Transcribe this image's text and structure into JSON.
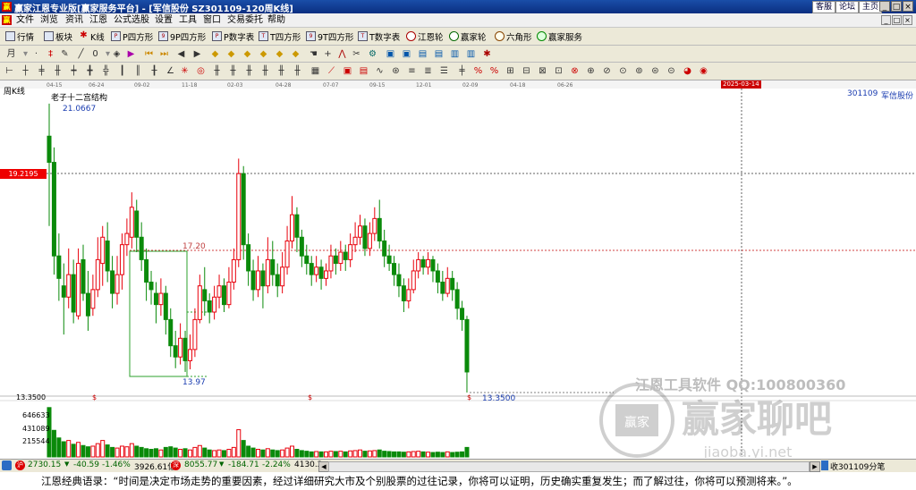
{
  "window": {
    "app_icon": "赢",
    "title": "赢家江恩专业版[赢家服务平台] - [军信股份  SZ301109-120周K线]",
    "links": [
      "客服",
      "论坛",
      "主页"
    ],
    "controls": [
      "_",
      "□",
      "×"
    ]
  },
  "menu": {
    "items": [
      "文件",
      "浏览",
      "资讯",
      "江恩",
      "公式选股",
      "设置",
      "工具",
      "窗口",
      "交易委托",
      "帮助"
    ],
    "controls": [
      "_",
      "□",
      "×"
    ]
  },
  "toolbar": {
    "items": [
      "行情",
      "板块",
      "K线",
      "P四方形",
      "9P四方形",
      "P数字表",
      "T四方形",
      "9T四方形",
      "T数字表",
      "江恩轮",
      "赢家轮",
      "六角形",
      "赢家服务"
    ]
  },
  "chart": {
    "period_label": "周K线",
    "structure_label": "老子十二宫结构",
    "stock_code": "301109",
    "stock_name": "军信股份",
    "date_ticks": [
      "04-15",
      "06-24",
      "09-02",
      "11-18",
      "02-03",
      "04-28",
      "07-07",
      "09-15",
      "12-01",
      "02-09",
      "04-18",
      "06-26"
    ],
    "cursor_date": "2025-03-14",
    "cursor_price": "19.2195",
    "high_label": "21.0667",
    "low_label": "13.3500",
    "box_top_label": "17.20",
    "box_bottom_label": "13.97",
    "price_axis_bottom": "13.3500",
    "volume_ticks": [
      "646633",
      "431089",
      "215544"
    ],
    "watermark_line1": "江恩工具软件  QQ:100800360",
    "watermark_brand": "赢家聊吧",
    "watermark_sub": "赢家",
    "watermark_url": "jiaoba.yi.net",
    "colors": {
      "up": "#e8000b",
      "down": "#0a8a0a",
      "box": "#2ca02c",
      "cursor": "#606060",
      "red_line": "#d04040"
    }
  },
  "chart_data": {
    "type": "candlestick",
    "note_candles": "[open, close, high, low]",
    "candles": [
      [
        20.2,
        19.5,
        21.07,
        17.8
      ],
      [
        19.5,
        17.0,
        19.9,
        16.5
      ],
      [
        17.0,
        16.4,
        17.6,
        15.8
      ],
      [
        16.2,
        15.9,
        16.8,
        14.9
      ],
      [
        15.9,
        16.5,
        17.2,
        15.6
      ],
      [
        16.5,
        15.5,
        16.9,
        15.2
      ],
      [
        15.4,
        16.8,
        17.2,
        15.3
      ],
      [
        16.9,
        16.0,
        17.3,
        15.8
      ],
      [
        16.0,
        15.4,
        16.6,
        15.0
      ],
      [
        15.6,
        16.1,
        16.5,
        15.4
      ],
      [
        16.1,
        16.9,
        17.5,
        15.9
      ],
      [
        16.8,
        17.5,
        17.8,
        16.2
      ],
      [
        17.4,
        16.6,
        17.9,
        16.3
      ],
      [
        16.6,
        16.0,
        17.0,
        15.6
      ],
      [
        16.0,
        16.5,
        17.0,
        15.7
      ],
      [
        16.5,
        17.3,
        17.6,
        16.1
      ],
      [
        17.3,
        17.6,
        18.0,
        17.0
      ],
      [
        17.5,
        18.3,
        18.7,
        17.2
      ],
      [
        18.2,
        17.5,
        18.5,
        17.1
      ],
      [
        17.5,
        16.9,
        17.9,
        16.6
      ],
      [
        16.9,
        16.3,
        17.2,
        15.8
      ],
      [
        16.3,
        16.1,
        16.6,
        15.7
      ],
      [
        16.0,
        15.7,
        16.3,
        15.2
      ],
      [
        15.7,
        16.0,
        16.4,
        15.4
      ],
      [
        16.0,
        15.3,
        16.2,
        14.9
      ],
      [
        15.3,
        14.6,
        15.6,
        14.3
      ],
      [
        14.6,
        14.3,
        15.0,
        14.0
      ],
      [
        14.3,
        14.8,
        15.2,
        14.1
      ],
      [
        14.8,
        14.2,
        15.0,
        13.9
      ],
      [
        14.2,
        14.5,
        14.9,
        13.97
      ],
      [
        14.5,
        15.3,
        15.6,
        14.3
      ],
      [
        15.3,
        16.2,
        16.5,
        15.2
      ],
      [
        16.1,
        15.8,
        16.7,
        15.4
      ],
      [
        15.8,
        15.5,
        16.0,
        15.2
      ],
      [
        15.5,
        15.9,
        16.2,
        15.3
      ],
      [
        15.9,
        16.2,
        16.5,
        15.6
      ],
      [
        16.2,
        15.7,
        16.4,
        15.5
      ],
      [
        15.7,
        16.3,
        16.7,
        15.6
      ],
      [
        16.3,
        16.9,
        17.2,
        16.1
      ],
      [
        16.9,
        19.2,
        19.6,
        16.7
      ],
      [
        19.2,
        17.3,
        19.4,
        16.9
      ],
      [
        17.3,
        16.6,
        17.6,
        16.2
      ],
      [
        16.6,
        16.1,
        16.9,
        15.8
      ],
      [
        16.1,
        16.6,
        17.0,
        15.9
      ],
      [
        16.6,
        16.2,
        16.8,
        15.6
      ],
      [
        16.2,
        16.9,
        17.5,
        16.0
      ],
      [
        16.9,
        16.5,
        17.4,
        16.2
      ],
      [
        16.5,
        16.2,
        16.8,
        15.9
      ],
      [
        16.2,
        16.7,
        17.1,
        16.0
      ],
      [
        16.7,
        17.4,
        17.8,
        16.5
      ],
      [
        17.4,
        18.1,
        18.6,
        17.2
      ],
      [
        18.1,
        17.5,
        18.3,
        17.1
      ],
      [
        17.5,
        17.0,
        17.7,
        16.7
      ],
      [
        17.0,
        16.8,
        17.3,
        16.5
      ],
      [
        16.8,
        16.5,
        17.0,
        16.2
      ],
      [
        16.5,
        16.7,
        17.0,
        16.3
      ],
      [
        16.7,
        16.4,
        16.9,
        16.1
      ],
      [
        16.4,
        16.6,
        16.8,
        16.2
      ],
      [
        16.6,
        17.0,
        17.3,
        16.4
      ],
      [
        17.0,
        16.8,
        17.2,
        16.5
      ],
      [
        16.8,
        17.1,
        17.4,
        16.6
      ],
      [
        17.1,
        16.9,
        17.3,
        16.6
      ],
      [
        16.9,
        17.3,
        17.6,
        16.7
      ],
      [
        17.3,
        17.5,
        17.9,
        17.1
      ],
      [
        17.5,
        17.8,
        18.1,
        17.3
      ],
      [
        17.8,
        17.2,
        18.0,
        17.0
      ],
      [
        17.2,
        17.6,
        17.9,
        17.0
      ],
      [
        17.6,
        18.0,
        18.3,
        17.4
      ],
      [
        18.0,
        17.4,
        18.5,
        17.2
      ],
      [
        17.4,
        17.0,
        17.7,
        16.7
      ],
      [
        17.0,
        16.8,
        17.3,
        16.6
      ],
      [
        16.8,
        16.5,
        17.0,
        16.2
      ],
      [
        16.5,
        16.2,
        16.8,
        15.9
      ],
      [
        16.2,
        15.8,
        16.4,
        15.5
      ],
      [
        15.8,
        16.1,
        16.4,
        15.6
      ],
      [
        16.1,
        16.6,
        16.9,
        16.0
      ],
      [
        16.6,
        16.9,
        17.1,
        16.4
      ],
      [
        16.9,
        16.7,
        17.0,
        16.5
      ],
      [
        16.7,
        16.9,
        17.1,
        16.5
      ],
      [
        16.9,
        16.6,
        17.0,
        16.3
      ],
      [
        16.6,
        16.3,
        16.8,
        16.0
      ],
      [
        16.3,
        16.0,
        16.6,
        15.8
      ],
      [
        16.0,
        16.4,
        16.7,
        15.9
      ],
      [
        16.4,
        16.1,
        16.6,
        15.8
      ],
      [
        16.1,
        15.6,
        16.3,
        15.3
      ],
      [
        15.6,
        15.3,
        15.8,
        15.0
      ],
      [
        15.3,
        13.9,
        15.4,
        13.35
      ]
    ],
    "volume_ymax": 862178,
    "volumes": [
      780000,
      420000,
      300000,
      240000,
      260000,
      200000,
      230000,
      180000,
      160000,
      170000,
      210000,
      260000,
      190000,
      150000,
      140000,
      170000,
      160000,
      210000,
      170000,
      150000,
      130000,
      120000,
      130000,
      110000,
      150000,
      160000,
      140000,
      120000,
      130000,
      110000,
      150000,
      180000,
      140000,
      110000,
      100000,
      110000,
      100000,
      120000,
      150000,
      430000,
      260000,
      170000,
      140000,
      120000,
      110000,
      130000,
      110000,
      100000,
      110000,
      140000,
      170000,
      120000,
      100000,
      90000,
      80000,
      85000,
      80000,
      80000,
      90000,
      85000,
      90000,
      80000,
      95000,
      100000,
      110000,
      90000,
      95000,
      100000,
      110000,
      90000,
      85000,
      80000,
      80000,
      75000,
      80000,
      85000,
      90000,
      80000,
      75000,
      70000,
      75000,
      70000,
      80000,
      70000,
      75000,
      80000,
      150000
    ],
    "ylim": [
      13.35,
      21.0667
    ],
    "x": [
      "04-15",
      "06-24",
      "09-02",
      "11-18",
      "02-03",
      "04-28",
      "07-07",
      "09-15",
      "12-01",
      "02-09",
      "04-18",
      "06-26"
    ]
  },
  "statusbar": {
    "sh_index": "2730.15",
    "sh_change": "-40.59",
    "sh_pct": "-1.46%",
    "sh_amount": "3926.61亿",
    "sz_index": "8055.77",
    "sz_change": "-184.71",
    "sz_pct": "-2.24%",
    "sz_amount": "4130.2",
    "trade_count": "收301109分笔"
  },
  "quote": {
    "text": "江恩经典语录：“时间是决定市场走势的重要因素，经过详细研究大市及个别股票的过往记录，你将可以证明，历史确实重复发生；而了解过往，你将可以预测将来。”。"
  }
}
